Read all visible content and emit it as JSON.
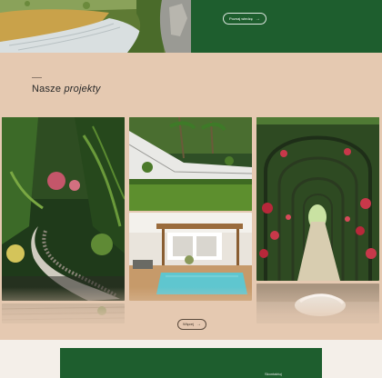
{
  "hero": {
    "cta_label": "Poznaj wiedzę",
    "cta_arrow": "→"
  },
  "projects": {
    "title_regular": "Nasze",
    "title_italic": "projekty",
    "more_label": "Więcej",
    "more_arrow": "→",
    "tiles": [
      {
        "subject": "tropical garden with stone path"
      },
      {
        "subject": "terraced lawn with palm trees"
      },
      {
        "subject": "pool with pergola terrace"
      },
      {
        "subject": "rose arch tunnel walkway"
      },
      {
        "subject": "interior with white chair"
      },
      {
        "subject": "wooden deck"
      }
    ]
  },
  "footer_block": {
    "label": "Skontaktuj"
  },
  "colors": {
    "forest_green": "#1e5e2e",
    "sand": "#e5c9b1",
    "cream": "#f4efe9"
  }
}
